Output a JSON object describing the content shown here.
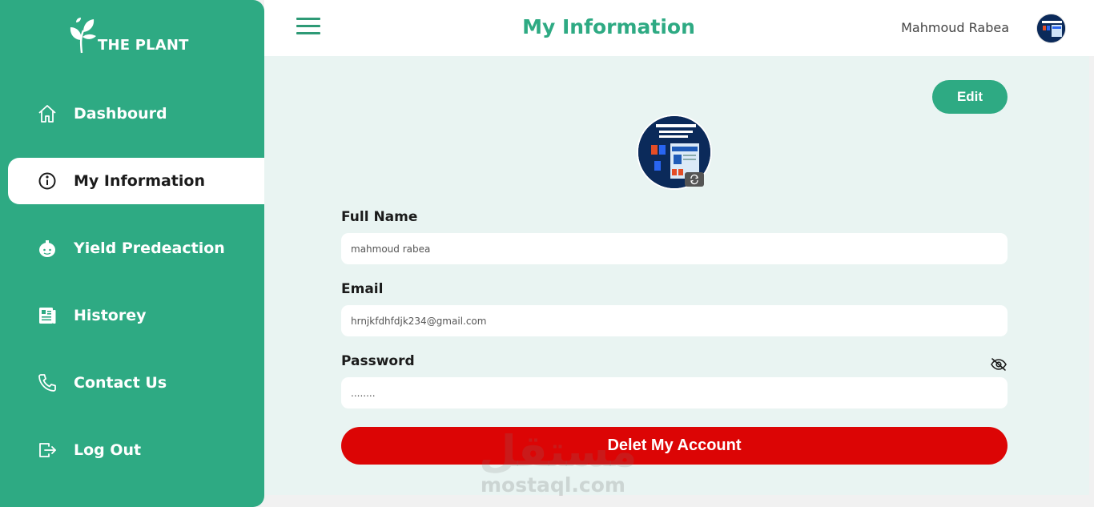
{
  "brand": {
    "name": "THE PLANT"
  },
  "sidebar": {
    "items": [
      {
        "label": "Dashbourd",
        "icon": "home-icon"
      },
      {
        "label": "My Information",
        "icon": "info-icon",
        "active": true
      },
      {
        "label": "Yield Predeaction",
        "icon": "yield-icon"
      },
      {
        "label": "Historey",
        "icon": "history-icon"
      },
      {
        "label": "Contact Us",
        "icon": "phone-icon"
      },
      {
        "label": "Log Out",
        "icon": "logout-icon"
      }
    ]
  },
  "header": {
    "title": "My Information",
    "user_name": "Mahmoud Rabea"
  },
  "main": {
    "edit_label": "Edit",
    "fields": {
      "full_name": {
        "label": "Full Name",
        "value": "mahmoud rabea"
      },
      "email": {
        "label": "Email",
        "value": "hrnjkfdhfdjk234@gmail.com"
      },
      "password": {
        "label": "Password",
        "value": "........"
      }
    },
    "delete_label": "Delet My Account"
  },
  "watermark": {
    "text": "mostaql.com",
    "arabic": "مستقل"
  },
  "colors": {
    "primary": "#2eaa83",
    "danger": "#dc0505",
    "background": "#e9f4f2"
  }
}
